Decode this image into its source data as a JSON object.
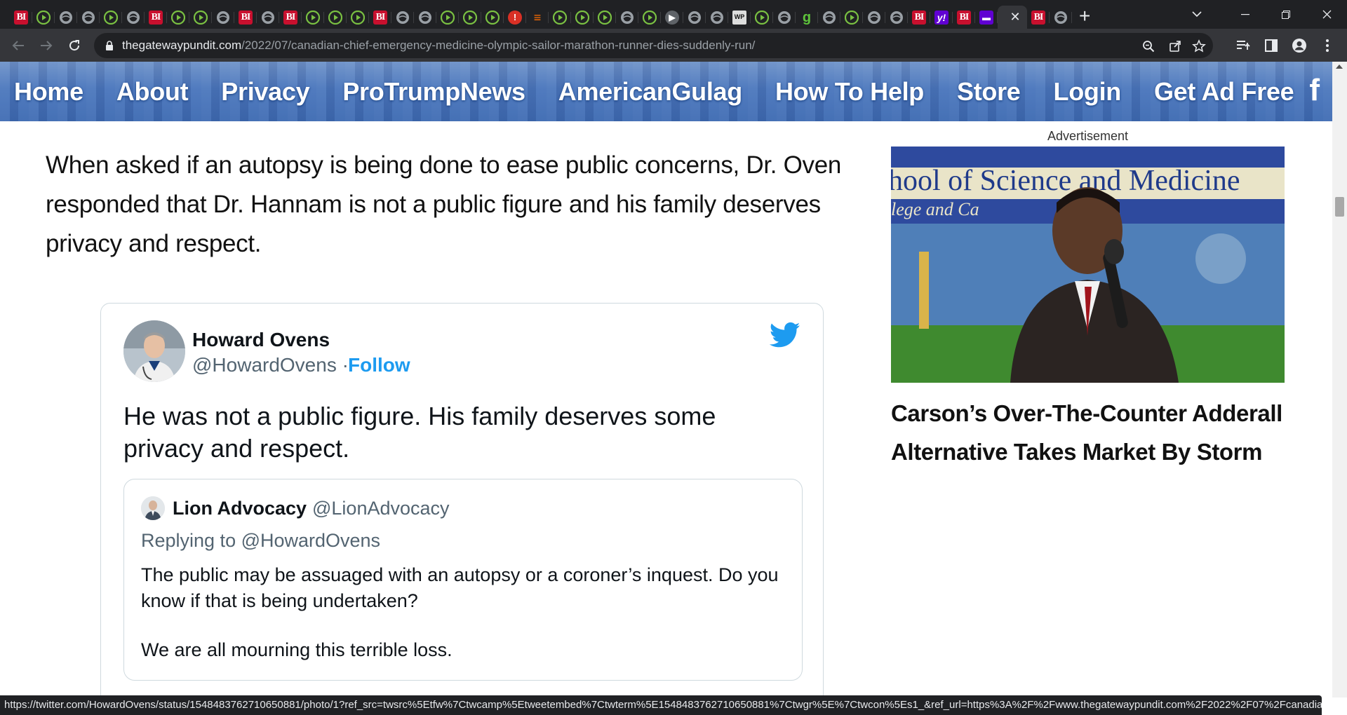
{
  "browser": {
    "tabs": [
      {
        "icon": "bi"
      },
      {
        "icon": "play"
      },
      {
        "icon": "globe"
      },
      {
        "icon": "globe"
      },
      {
        "icon": "play"
      },
      {
        "icon": "globe"
      },
      {
        "icon": "bi"
      },
      {
        "icon": "play"
      },
      {
        "icon": "play"
      },
      {
        "icon": "globe"
      },
      {
        "icon": "bi"
      },
      {
        "icon": "globe"
      },
      {
        "icon": "bi"
      },
      {
        "icon": "play"
      },
      {
        "icon": "play"
      },
      {
        "icon": "play"
      },
      {
        "icon": "bi"
      },
      {
        "icon": "globe"
      },
      {
        "icon": "globe"
      },
      {
        "icon": "play"
      },
      {
        "icon": "play"
      },
      {
        "icon": "play"
      },
      {
        "icon": "red"
      },
      {
        "icon": "book"
      },
      {
        "icon": "play"
      },
      {
        "icon": "play"
      },
      {
        "icon": "play"
      },
      {
        "icon": "globe"
      },
      {
        "icon": "play"
      },
      {
        "icon": "dark"
      },
      {
        "icon": "globe"
      },
      {
        "icon": "globe"
      },
      {
        "icon": "wp"
      },
      {
        "icon": "play"
      },
      {
        "icon": "globe"
      },
      {
        "icon": "g"
      },
      {
        "icon": "globe"
      },
      {
        "icon": "play"
      },
      {
        "icon": "globe"
      },
      {
        "icon": "globe"
      },
      {
        "icon": "bi"
      },
      {
        "icon": "yahoo"
      },
      {
        "icon": "bi"
      },
      {
        "icon": "ms"
      },
      {
        "icon": "active"
      },
      {
        "icon": "bi"
      },
      {
        "icon": "globe"
      }
    ],
    "new_tab_label": "+",
    "url_host": "thegatewaypundit.com",
    "url_path": "/2022/07/canadian-chief-emergency-medicine-olympic-sailor-marathon-runner-dies-suddenly-run/",
    "status_url": "https://twitter.com/HowardOvens/status/1548483762710650881/photo/1?ref_src=twsrc%5Etfw%7Ctwcamp%5Etweetembed%7Ctwterm%5E1548483762710650881%7Ctwgr%5E%7Ctwcon%5Es1_&ref_url=https%3A%2F%2Fwww.thegatewaypundit.com%2F2022%2F07%2Fcanadian-..."
  },
  "site_nav": {
    "links": [
      "Home",
      "About",
      "Privacy",
      "ProTrumpNews",
      "AmericanGulag",
      "How To Help",
      "Store",
      "Login",
      "Get Ad Free"
    ],
    "facebook": "f"
  },
  "article": {
    "paragraph": "When asked if an autopsy is being done to ease public concerns, Dr. Oven responded that Dr. Hannam is not a public figure and his family deserves privacy and respect."
  },
  "tweet": {
    "name": "Howard Ovens",
    "handle": "@HowardOvens ·",
    "follow": "Follow",
    "text": "He was not a public figure. His family deserves some privacy and respect.",
    "quote": {
      "name": "Lion Advocacy",
      "handle": "@LionAdvocacy",
      "replying": "Replying to @HowardOvens",
      "text1": "The public may be assuaged with an autopsy or a coroner’s inquest. Do you know if that is being undertaken?",
      "text2": "We are all mourning this terrible loss."
    }
  },
  "ad": {
    "label": "Advertisement",
    "banner_text": "hool of Science and Medicine",
    "banner_sub": "lege and Ca",
    "title": "Carson’s Over-The-Counter Adderall Alternative Takes Market By Storm"
  },
  "colors": {
    "twitter_blue": "#1d9bf0",
    "nav_blue": "#4b77bd",
    "chrome_dark": "#202124"
  }
}
